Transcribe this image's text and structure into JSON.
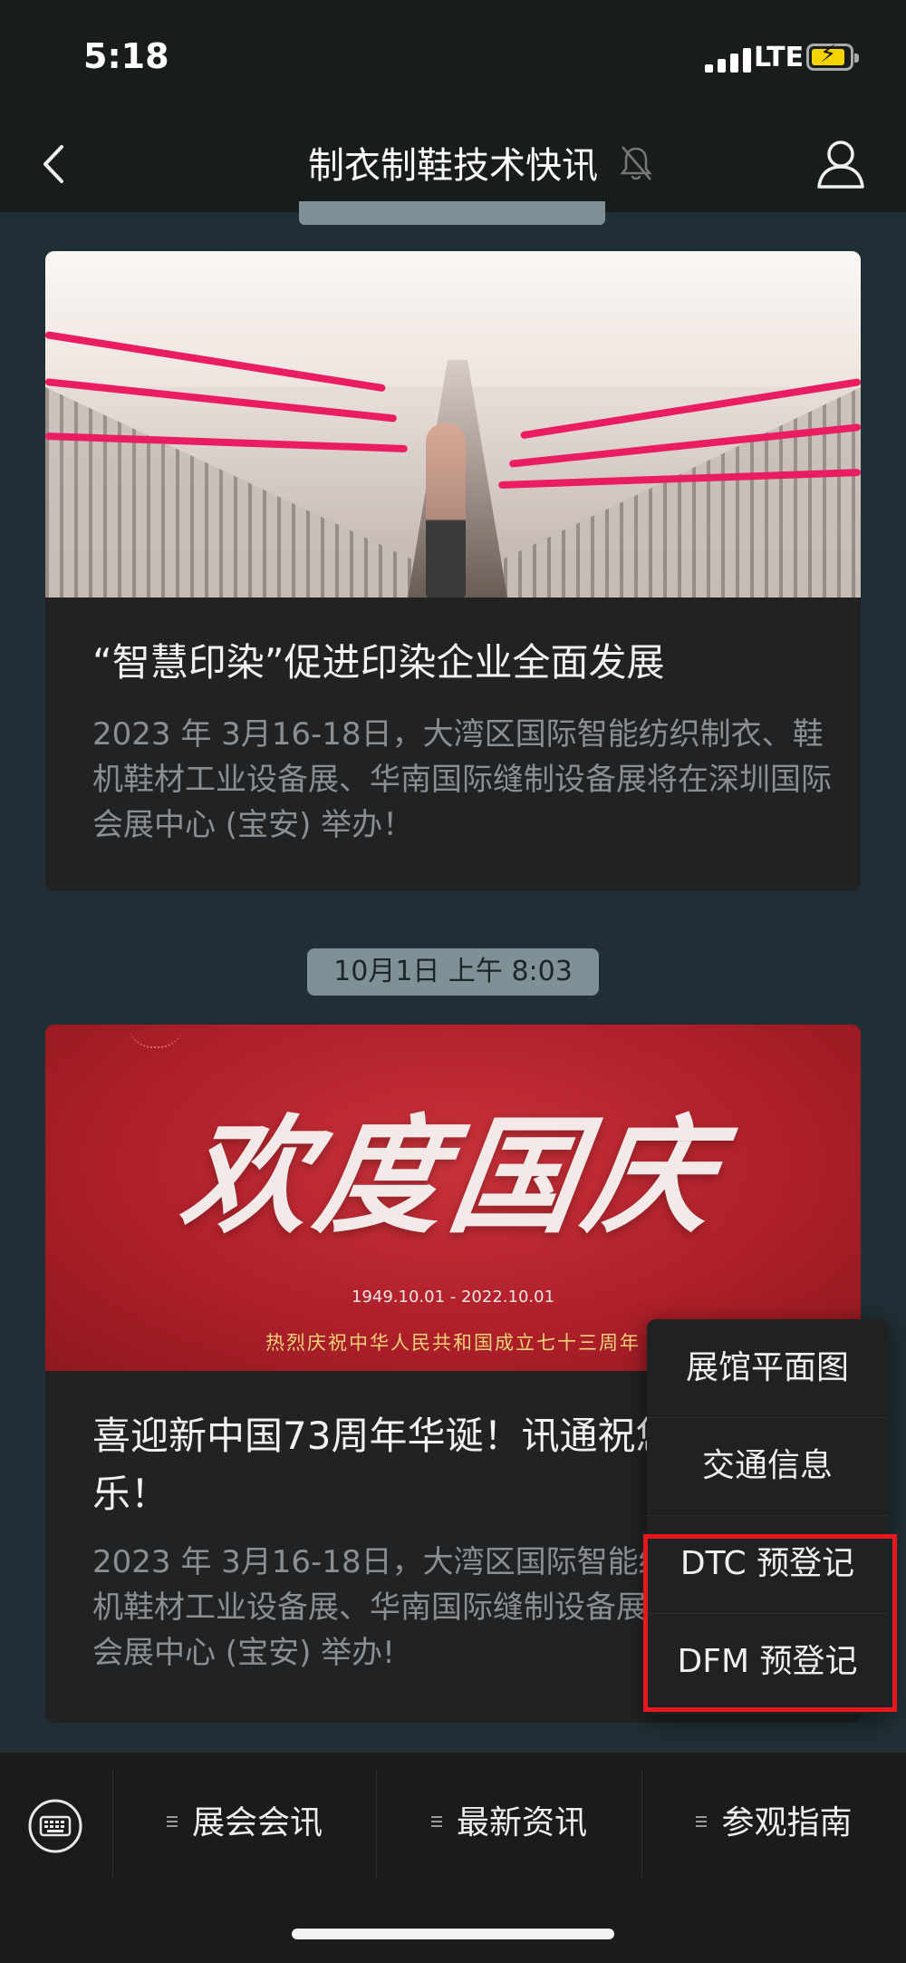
{
  "status_bar": {
    "time": "5:18",
    "network": "LTE"
  },
  "nav": {
    "title": "制衣制鞋技术快讯"
  },
  "messages": [
    {
      "title": "“智慧印染”促进印染企业全面发展",
      "description": "2023 年 3月16-18日，大湾区国际智能纺织制衣、鞋机鞋材工业设备展、华南国际缝制设备展将在深圳国际会展中心 (宝安) 举办！"
    },
    {
      "timestamp": "10月1日 上午 8:03",
      "image_text": {
        "headline": "欢度国庆",
        "dates": "1949.10.01 - 2022.10.01",
        "greeting": "热烈庆祝中华人民共和国成立七十三周年"
      },
      "title": "喜迎新中国73周年华诞！讯通祝您国庆快乐！",
      "description": "2023 年 3月16-18日，大湾区国际智能纺织制衣、鞋机鞋材工业设备展、华南国际缝制设备展将在深圳国际会展中心 (宝安) 举办!"
    }
  ],
  "popup_menu": {
    "items": [
      "展馆平面图",
      "交通信息",
      "DTC 预登记",
      "DFM 预登记"
    ]
  },
  "bottom_tabs": [
    "展会会讯",
    "最新资讯",
    "参观指南"
  ],
  "colors": {
    "highlight": "#e6171d",
    "timestamp_bg": "#7f9196"
  }
}
